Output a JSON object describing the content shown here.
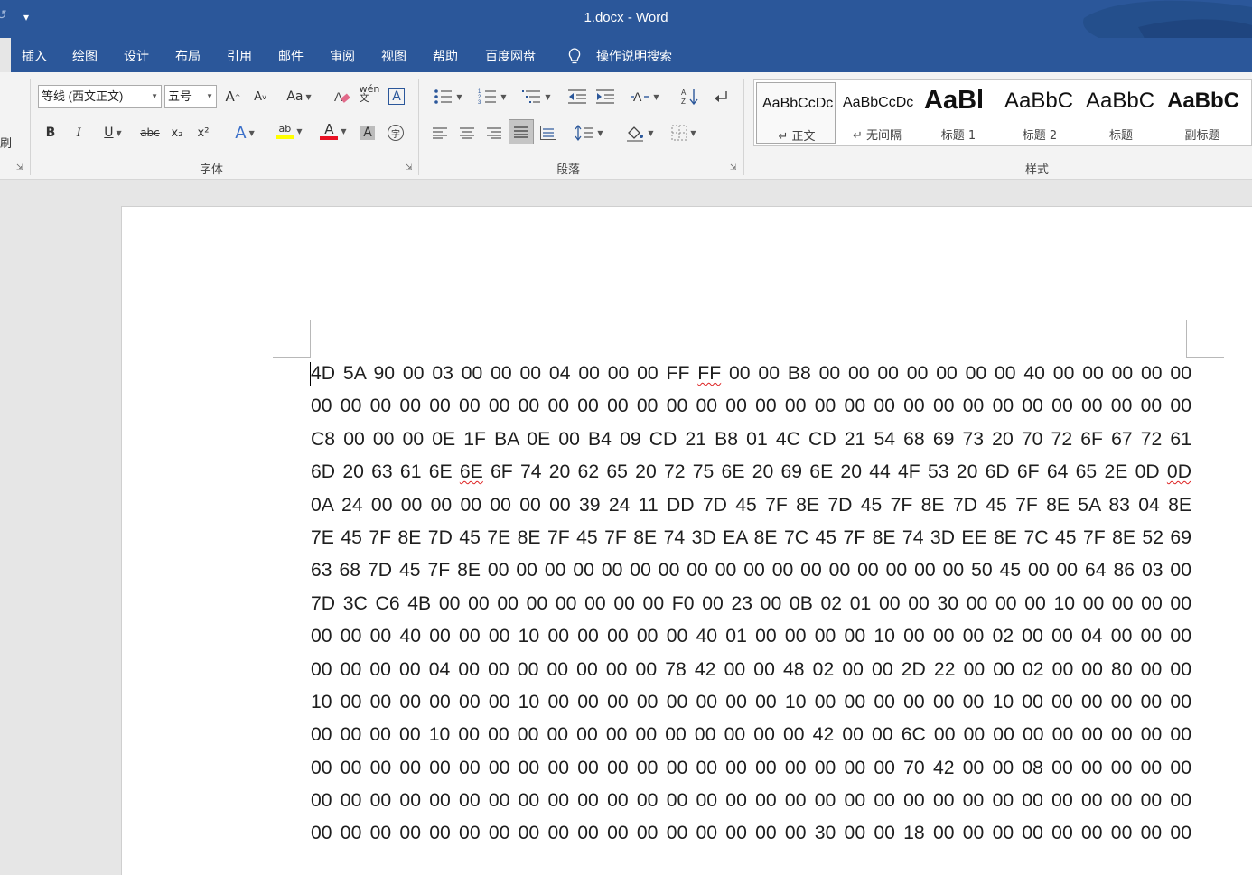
{
  "titlebar": {
    "quick_access_icon": "undo-icon",
    "customize_icon": "dropdown-arrow-icon",
    "title": "1.docx  -  Word"
  },
  "tabs": [
    "插入",
    "绘图",
    "设计",
    "布局",
    "引用",
    "邮件",
    "审阅",
    "视图",
    "帮助",
    "百度网盘"
  ],
  "tell_me": {
    "icon": "lightbulb-icon",
    "label": "操作说明搜索"
  },
  "ribbon": {
    "clipboard_partial_label": "刷",
    "font": {
      "group_label": "字体",
      "font_name": "等线 (西文正文)",
      "font_size": "五号",
      "buttons": {
        "grow": "A",
        "shrink": "A",
        "case": "Aa",
        "clear_format_icon": "clear-format-icon",
        "phonetic": "wén 文",
        "char_border": "A",
        "bold": "B",
        "italic": "I",
        "underline": "U",
        "strike": "abc",
        "subscript": "x₂",
        "superscript": "x²",
        "text_effects": "A",
        "highlight": "ab",
        "font_color": "A",
        "char_shading": "A",
        "enclose": "字"
      },
      "colors": {
        "highlight": "#ffff00",
        "font_color": "#e81123"
      }
    },
    "paragraph": {
      "group_label": "段落"
    },
    "styles": {
      "group_label": "样式",
      "items": [
        {
          "sample": "AaBbCcDc",
          "name": "↵ 正文",
          "selected": true
        },
        {
          "sample": "AaBbCcDc",
          "name": "↵ 无间隔",
          "selected": false
        },
        {
          "sample": "AaBl",
          "name": "标题 1",
          "selected": false
        },
        {
          "sample": "AaBbC",
          "name": "标题 2",
          "selected": false
        },
        {
          "sample": "AaBbC",
          "name": "标题",
          "selected": false
        },
        {
          "sample": "AaBbC",
          "name": "副标题",
          "selected": false
        }
      ]
    }
  },
  "document": {
    "lines": [
      "4D 5A 90 00 03 00 00 00 04 00 00 00 FF FF 00 00 B8 00 00 00 00 00 00 00 40 00 00 00 00 00",
      "00 00 00 00 00 00 00 00 00 00 00 00 00 00 00 00 00 00 00 00 00 00 00 00 00 00 00 00 00 00",
      "C8 00 00 00 0E 1F BA 0E 00 B4 09 CD 21 B8 01 4C CD 21 54 68 69 73 20 70 72 6F 67 72 61",
      "6D 20 63 61 6E 6E 6F 74 20 62 65 20 72 75 6E 20 69 6E 20 44 4F 53 20 6D 6F 64 65 2E 0D 0D",
      "0A 24 00 00 00 00 00 00 00 39 24 11 DD 7D 45 7F 8E 7D 45 7F 8E 7D 45 7F 8E 5A 83 04 8E",
      "7E 45 7F 8E 7D 45 7E 8E 7F 45 7F 8E 74 3D EA 8E 7C 45 7F 8E 74 3D EE 8E 7C 45 7F 8E 52 69",
      "63 68 7D 45 7F 8E 00 00 00 00 00 00 00 00 00 00 00 00 00 00 00 00 00 50 45 00 00 64 86 03 00",
      "7D 3C C6 4B 00 00 00 00 00 00 00 00 F0 00 23 00 0B 02 01 00 00 30 00 00 00 10 00 00 00 00",
      "00 00 00 40 00 00 00 10 00 00 00 00 00 40 01 00 00 00 00 10 00 00 00 02 00 00 04 00 00 00",
      "00 00 00 00 04 00 00 00 00 00 00 00 78 42 00 00 48 02 00 00 2D 22 00 00 02 00 00 80 00 00",
      "10 00 00 00 00 00 00 10 00 00 00 00 00 00 00 00 10 00 00 00 00 00 00 10 00 00 00 00 00 00",
      "00 00 00 00 10 00 00 00 00 00 00 00 00 00 00 00 00 42 00 00 6C 00 00 00 00 00 00 00 00 00",
      "00 00 00 00 00 00 00 00 00 00 00 00 00 00 00 00 00 00 00 00 70 42 00 00 08 00 00 00 00 00",
      "00 00 00 00 00 00 00 00 00 00 00 00 00 00 00 00 00 00 00 00 00 00 00 00 00 00 00 00 00 00",
      "00 00 00 00 00 00 00 00 00 00 00 00 00 00 00 00 00 30 00 00 18 00 00 00 00 00 00 00 00 00"
    ]
  }
}
